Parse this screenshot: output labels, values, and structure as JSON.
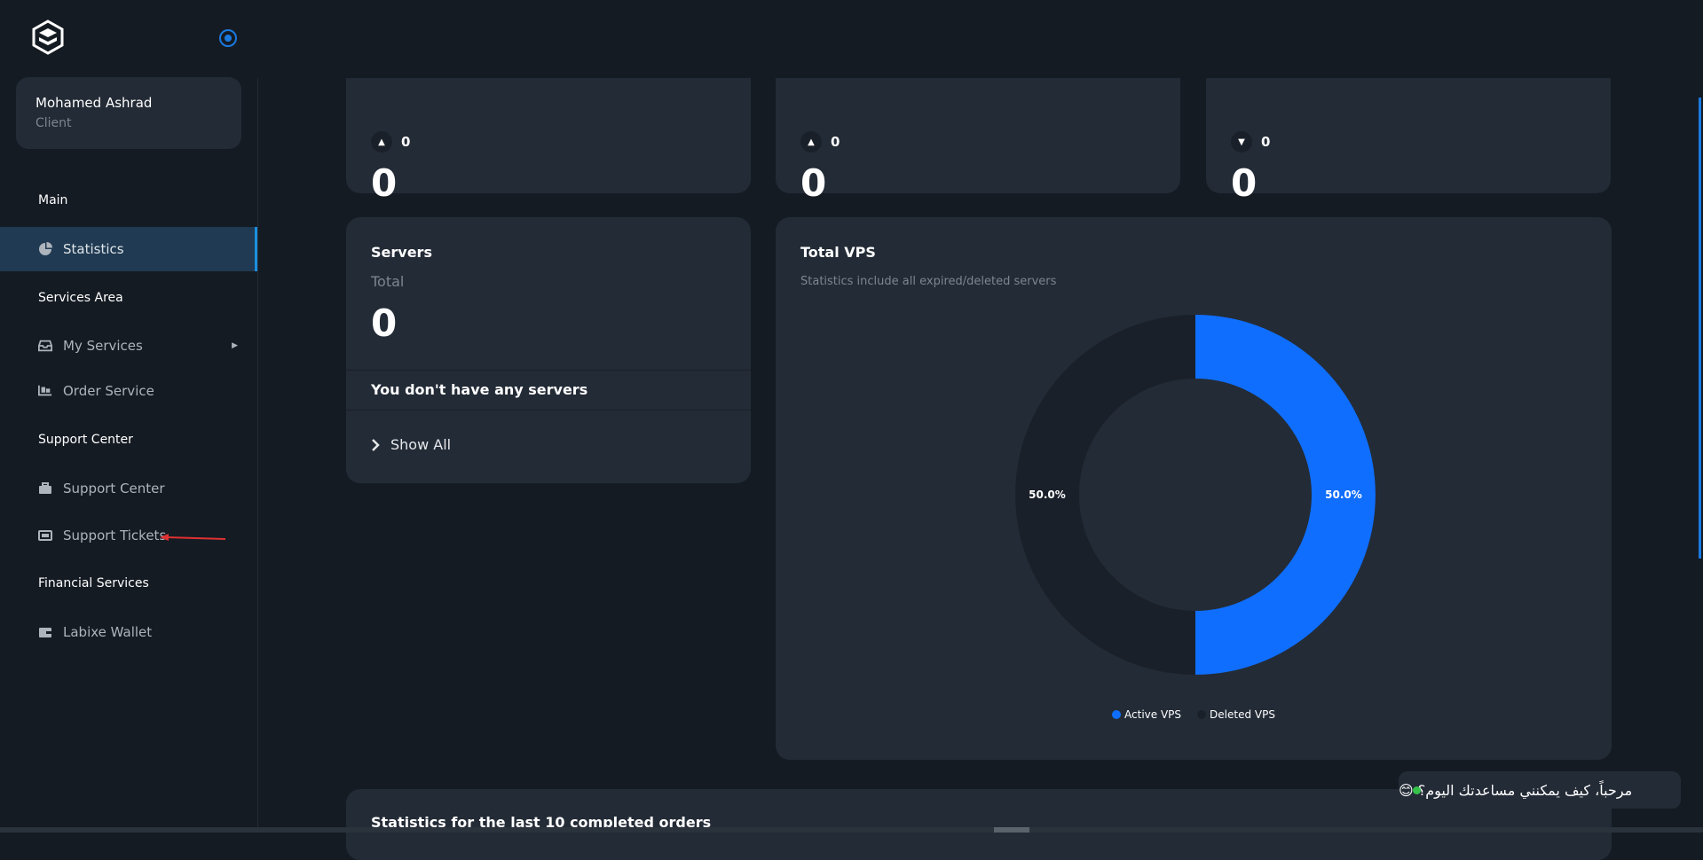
{
  "user": {
    "name": "Mohamed Ashrad",
    "role": "Client"
  },
  "sidebar": {
    "sections": [
      {
        "title": "Main"
      },
      {
        "title": "Services Area"
      },
      {
        "title": "Support Center"
      },
      {
        "title": "Financial Services"
      }
    ],
    "items": [
      {
        "label": "Statistics",
        "icon": "pie-chart-icon",
        "active": true
      },
      {
        "label": "My Services",
        "icon": "inbox-icon"
      },
      {
        "label": "Order Service",
        "icon": "cart-icon"
      },
      {
        "label": "Support Center",
        "icon": "toolbox-icon"
      },
      {
        "label": "Support Tickets",
        "icon": "ticket-icon"
      },
      {
        "label": "Labixe Wallet",
        "icon": "wallet-icon"
      }
    ]
  },
  "stats": [
    {
      "trend_value": "0",
      "trend": "up",
      "value": "0"
    },
    {
      "trend_value": "0",
      "trend": "up",
      "value": "0"
    },
    {
      "trend_value": "0",
      "trend": "down",
      "value": "0"
    }
  ],
  "servers": {
    "title": "Servers",
    "subtitle": "Total",
    "value": "0",
    "empty_message": "You don't have any servers",
    "show_all": "Show All"
  },
  "vps": {
    "title": "Total VPS",
    "subtitle": "Statistics include all expired/deleted servers"
  },
  "chart_data": {
    "type": "pie",
    "categories": [
      "Active VPS",
      "Deleted VPS"
    ],
    "values": [
      50.0,
      50.0
    ],
    "labels": [
      "50.0%",
      "50.0%"
    ],
    "colors": [
      "#0f6efd",
      "#1a2029"
    ],
    "legend_position": "bottom"
  },
  "orders": {
    "title": "Statistics for the last 10 completed orders"
  },
  "chat": {
    "message": "مرحباً، كيف يمكنني مساعدتك اليوم؟ 😊"
  },
  "colors": {
    "accent": "#0f6efd",
    "sidebar_active": "#1f3a52",
    "card": "#232b36",
    "background": "#151b23"
  }
}
